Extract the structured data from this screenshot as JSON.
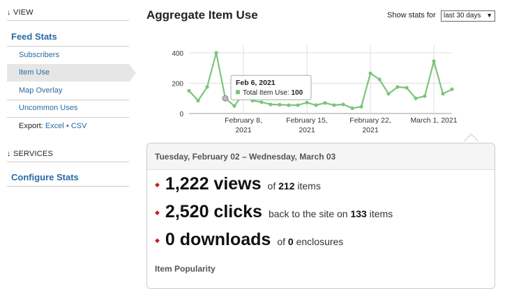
{
  "sidebar": {
    "view_label": "↓ VIEW",
    "feed_stats": "Feed Stats",
    "items": [
      {
        "label": "Subscribers"
      },
      {
        "label": "Item Use"
      },
      {
        "label": "Map Overlay"
      },
      {
        "label": "Uncommon Uses"
      }
    ],
    "export_prefix": "Export:",
    "export_excel": "Excel",
    "export_sep": "•",
    "export_csv": "CSV",
    "services_label": "↓ SERVICES",
    "configure_stats": "Configure Stats"
  },
  "header": {
    "title": "Aggregate Item Use",
    "stats_for_label": "Show stats for",
    "period_value": "last 30 days"
  },
  "chart_data": {
    "type": "line",
    "series": [
      {
        "name": "Total Item Use",
        "x": [
          "2021-02-02",
          "2021-02-03",
          "2021-02-04",
          "2021-02-05",
          "2021-02-06",
          "2021-02-07",
          "2021-02-08",
          "2021-02-09",
          "2021-02-10",
          "2021-02-11",
          "2021-02-12",
          "2021-02-13",
          "2021-02-14",
          "2021-02-15",
          "2021-02-16",
          "2021-02-17",
          "2021-02-18",
          "2021-02-19",
          "2021-02-20",
          "2021-02-21",
          "2021-02-22",
          "2021-02-23",
          "2021-02-24",
          "2021-02-25",
          "2021-02-26",
          "2021-02-27",
          "2021-02-28",
          "2021-03-01",
          "2021-03-02",
          "2021-03-03"
        ],
        "values": [
          150,
          85,
          175,
          400,
          100,
          50,
          130,
          85,
          75,
          60,
          58,
          55,
          55,
          72,
          55,
          70,
          55,
          60,
          35,
          45,
          265,
          225,
          130,
          175,
          170,
          100,
          115,
          345,
          130,
          160
        ]
      }
    ],
    "yticks": [
      0,
      200,
      400
    ],
    "ylim": [
      0,
      450
    ],
    "xtick_labels": [
      {
        "date": "2021-02-08",
        "line1": "February 8,",
        "line2": "2021"
      },
      {
        "date": "2021-02-15",
        "line1": "February 15,",
        "line2": "2021"
      },
      {
        "date": "2021-02-22",
        "line1": "February 22,",
        "line2": "2021"
      },
      {
        "date": "2021-03-01",
        "line1": "March 1, 2021",
        "line2": ""
      }
    ],
    "tooltip": {
      "date_label": "Feb 6, 2021",
      "series_label": "Total Item Use:",
      "value": "100",
      "index": 4
    },
    "line_color": "#7cc47c",
    "grid": true
  },
  "summary": {
    "date_range": "Tuesday, February 02 – Wednesday, March 03",
    "views_big": "1,222 views",
    "views_of": "of",
    "views_items_count": "212",
    "views_items_word": "items",
    "clicks_big": "2,520 clicks",
    "clicks_text": "back to the site on",
    "clicks_count": "133",
    "clicks_word": "items",
    "downloads_big": "0 downloads",
    "downloads_of": "of",
    "downloads_count": "0",
    "downloads_word": "enclosures",
    "popularity_title": "Item Popularity",
    "bullet": "◆"
  }
}
